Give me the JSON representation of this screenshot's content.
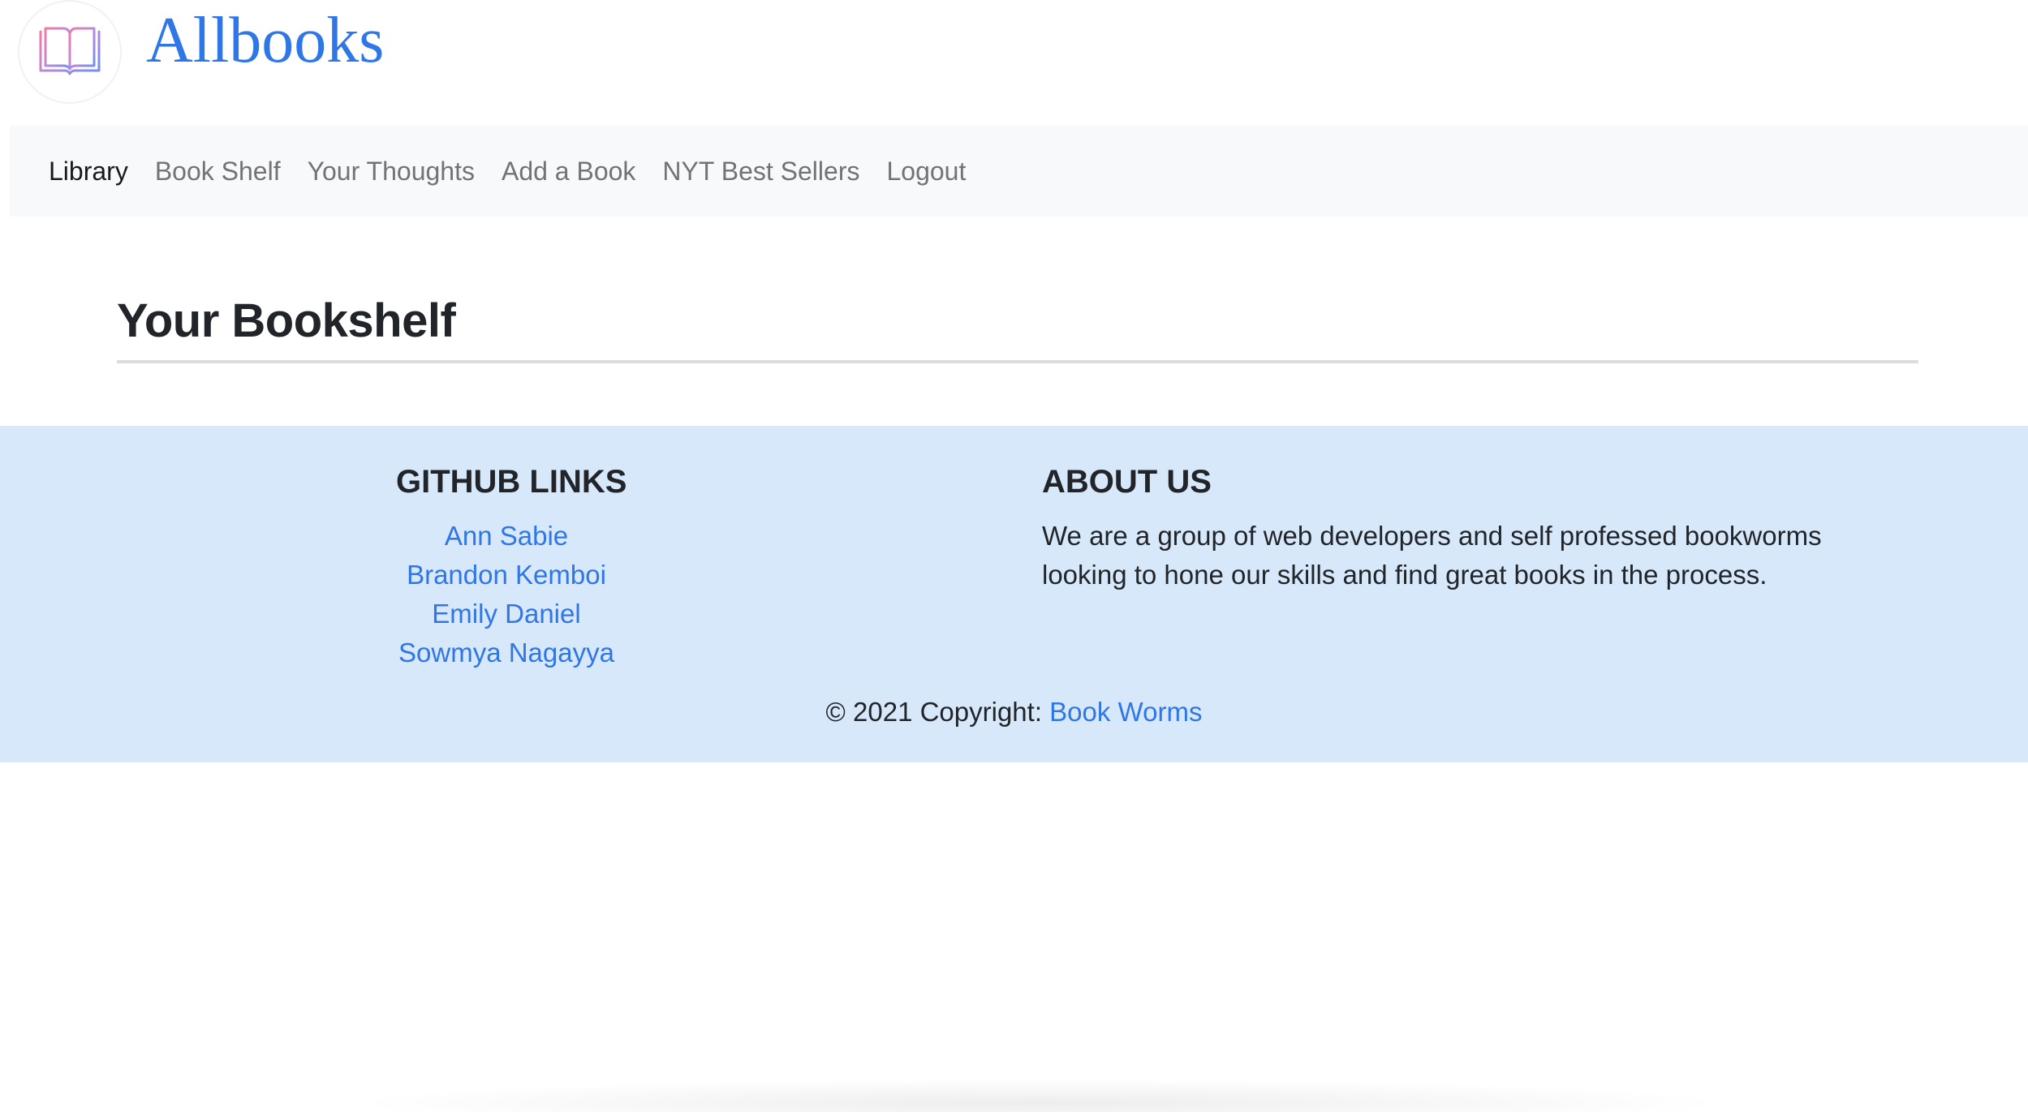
{
  "header": {
    "brand_name": "Allbooks",
    "logo_icon": "open-book-icon"
  },
  "nav": {
    "items": [
      {
        "label": "Library",
        "active": true
      },
      {
        "label": "Book Shelf",
        "active": false
      },
      {
        "label": "Your Thoughts",
        "active": false
      },
      {
        "label": "Add a Book",
        "active": false
      },
      {
        "label": "NYT Best Sellers",
        "active": false
      },
      {
        "label": "Logout",
        "active": false
      }
    ]
  },
  "main": {
    "title": "Your Bookshelf"
  },
  "footer": {
    "github_heading": "GITHUB LINKS",
    "github_links": [
      "Ann Sabie",
      "Brandon Kemboi",
      "Emily Daniel",
      "Sowmya Nagayya"
    ],
    "about_heading": "ABOUT US",
    "about_text": "We are a group of web developers and self professed bookworms looking to hone our skills and find great books in the process.",
    "copyright_prefix": "© 2021 Copyright: ",
    "copyright_link": "Book Worms"
  },
  "colors": {
    "link": "#2f76e6",
    "footer_bg": "#d8e8fb",
    "navbar_bg": "#f8f9fa"
  }
}
